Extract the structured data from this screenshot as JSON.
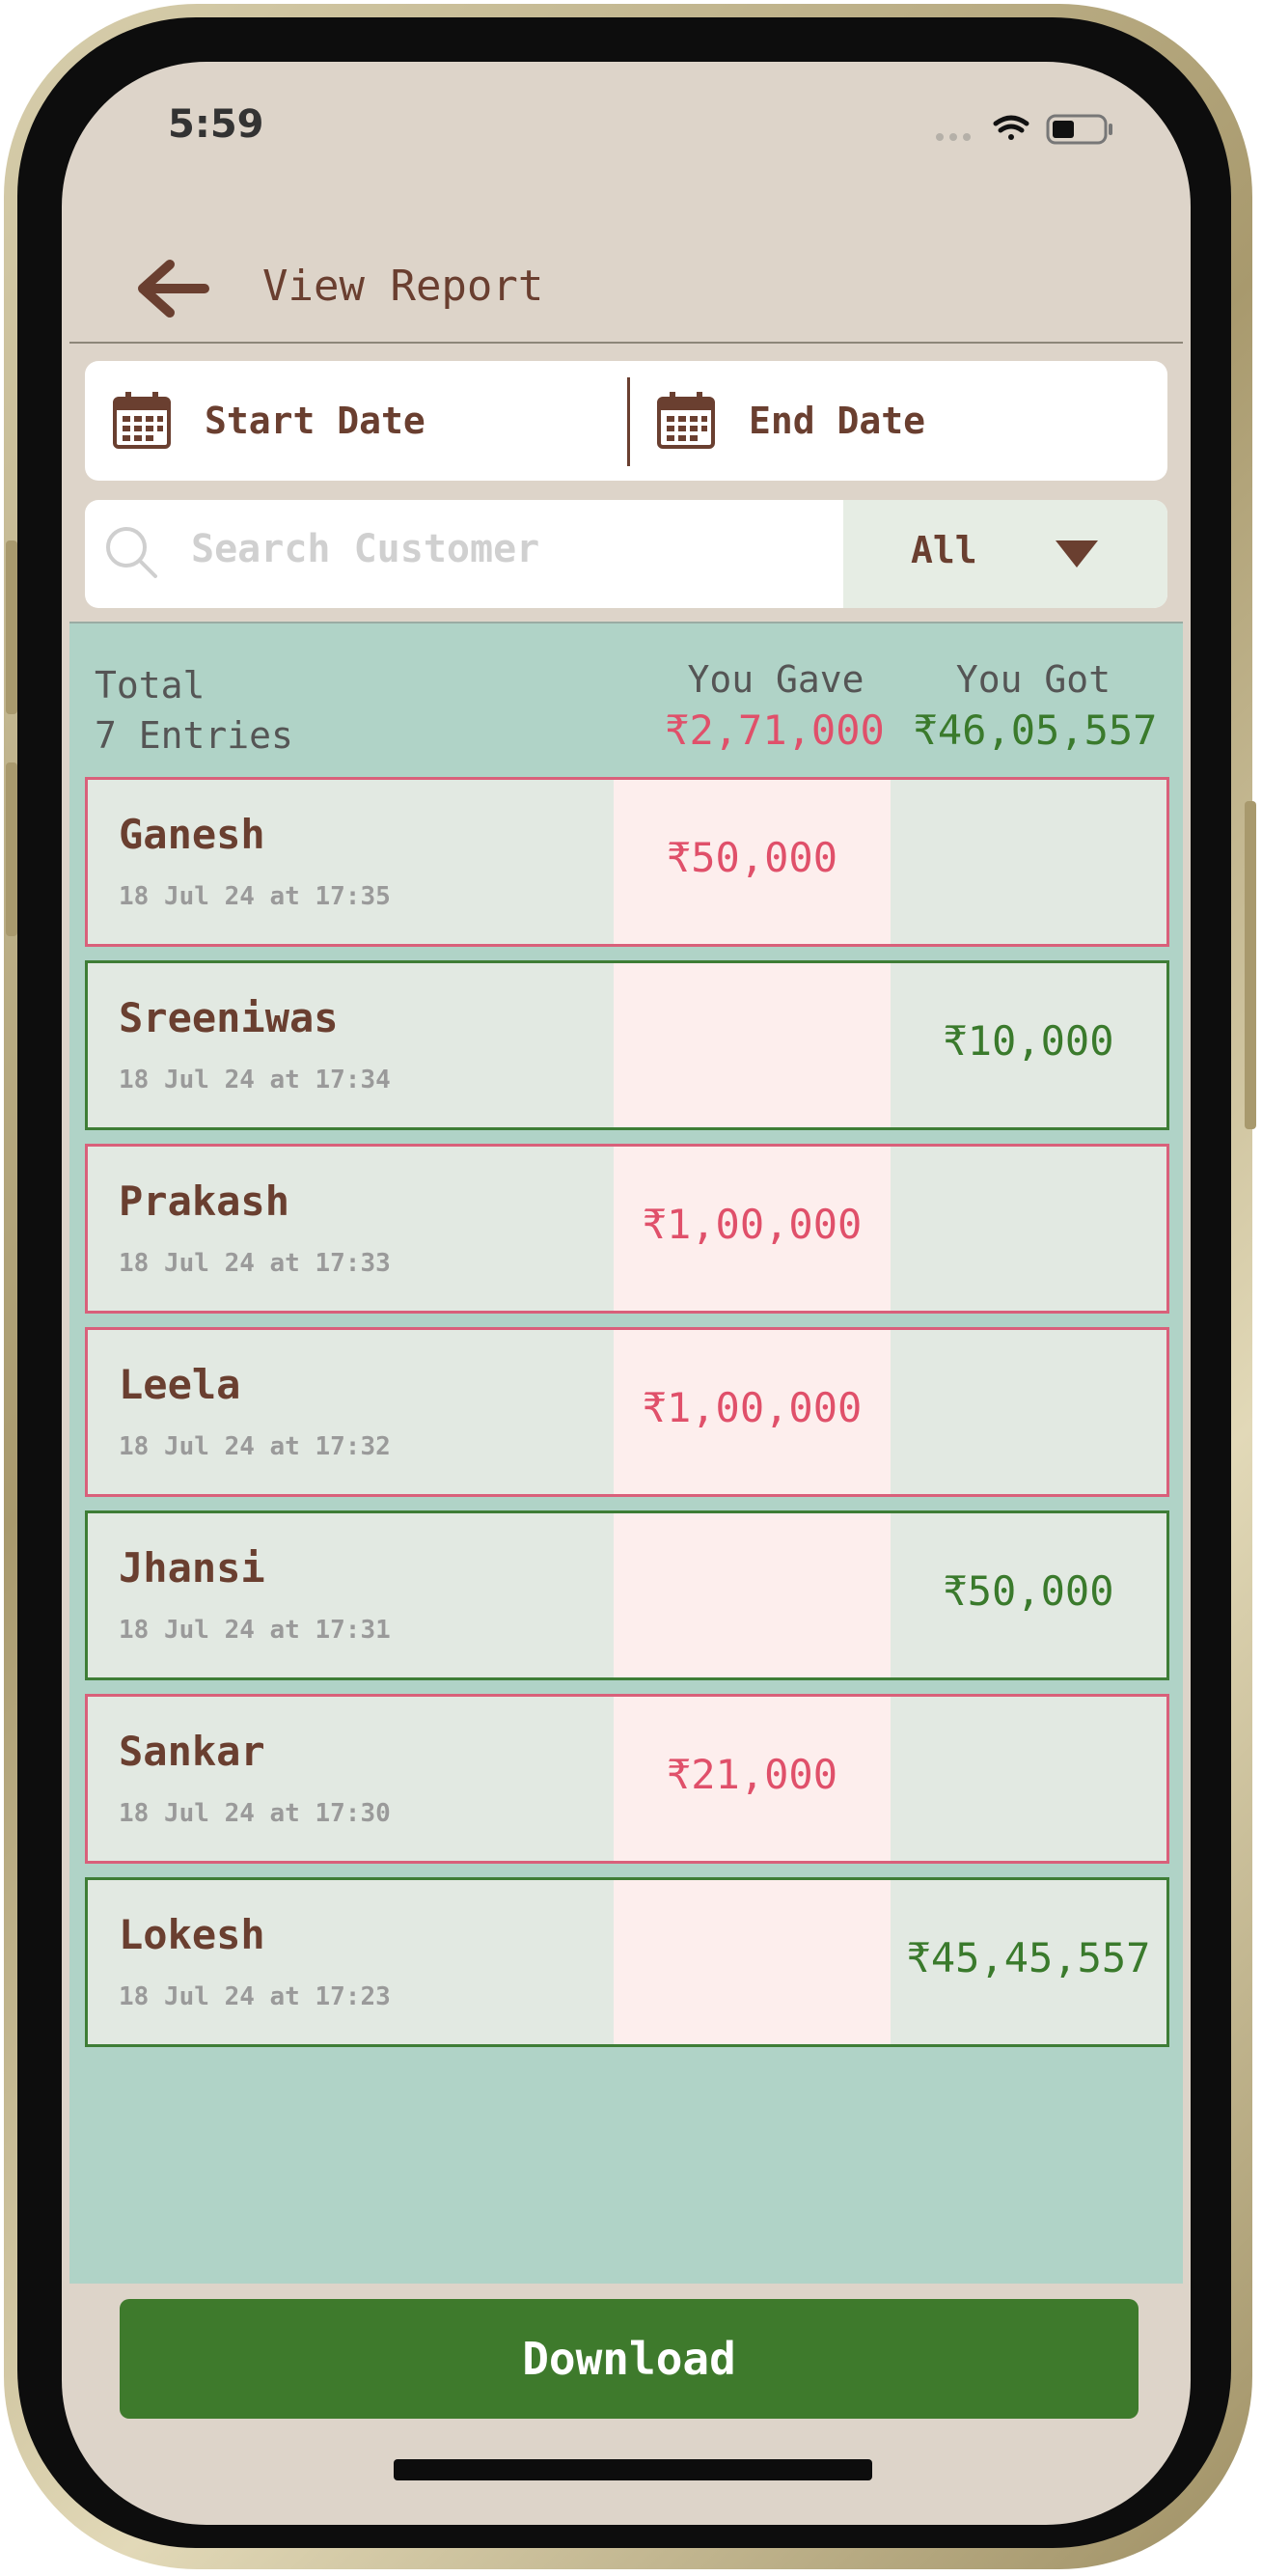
{
  "status": {
    "time": "5:59"
  },
  "header": {
    "title": "View Report"
  },
  "dates": {
    "start_label": "Start Date",
    "end_label": "End Date"
  },
  "search": {
    "placeholder": "Search Customer",
    "filter_value": "All"
  },
  "summary": {
    "total_label": "Total",
    "entries": "7 Entries",
    "gave_header": "You Gave",
    "got_header": "You Got",
    "gave_total": "₹2,71,000",
    "got_total": "₹46,05,557"
  },
  "entries": [
    {
      "name": "Ganesh",
      "time": "18 Jul 24 at 17:35",
      "gave": "₹50,000",
      "got": ""
    },
    {
      "name": "Sreeniwas",
      "time": "18 Jul 24 at 17:34",
      "gave": "",
      "got": "₹10,000"
    },
    {
      "name": "Prakash",
      "time": "18 Jul 24 at 17:33",
      "gave": "₹1,00,000",
      "got": ""
    },
    {
      "name": "Leela",
      "time": "18 Jul 24 at 17:32",
      "gave": "₹1,00,000",
      "got": ""
    },
    {
      "name": "Jhansi",
      "time": "18 Jul 24 at 17:31",
      "gave": "",
      "got": "₹50,000"
    },
    {
      "name": "Sankar",
      "time": "18 Jul 24 at 17:30",
      "gave": "₹21,000",
      "got": ""
    },
    {
      "name": "Lokesh",
      "time": "18 Jul 24 at 17:23",
      "gave": "",
      "got": "₹45,45,557"
    }
  ],
  "actions": {
    "download_label": "Download"
  },
  "colors": {
    "gave": "#e0506a",
    "got": "#3a7a2c",
    "accent": "#3e7a2c",
    "brown": "#6a3f30"
  }
}
